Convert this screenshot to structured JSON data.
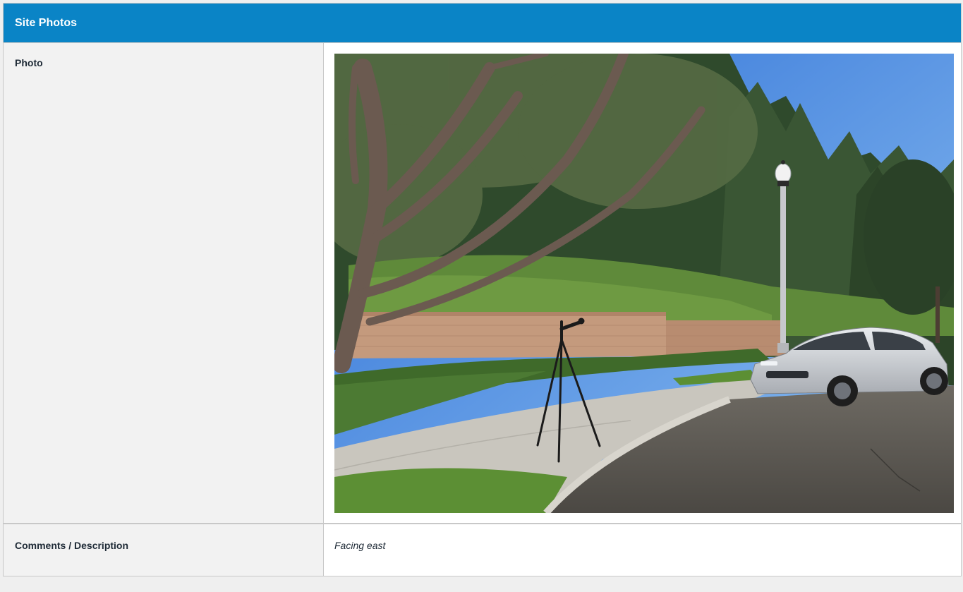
{
  "section": {
    "title": "Site Photos"
  },
  "rows": [
    {
      "label": "Photo"
    },
    {
      "label": "Comments / Description",
      "value": "Facing east"
    }
  ],
  "photo": {
    "subject": "tripod-with-microphone-on-sidewalk-beside-silver-car",
    "colors": {
      "sky": "#5d9ee6",
      "trees": "#3f5b37",
      "wall": "#c49a7d",
      "sidewalk": "#c7c4bc",
      "road": "#5b5852",
      "car": "#cfd3d8"
    }
  },
  "colors": {
    "header_bg": "#0a84c6",
    "label_bg": "#f2f2f2",
    "border": "#c8c8c8",
    "text": "#1e2a36"
  }
}
